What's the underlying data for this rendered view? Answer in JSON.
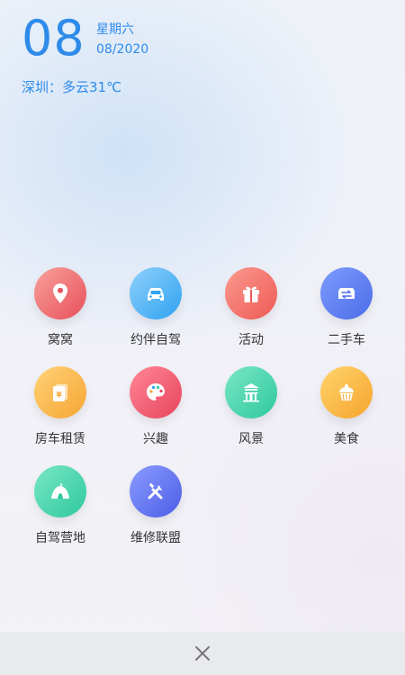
{
  "date": {
    "day": "08",
    "weekday": "星期六",
    "month_year": "08/2020",
    "weather": "深圳：多云31℃"
  },
  "menu": {
    "items": [
      {
        "label": "窝窝",
        "icon": "location-pin-icon",
        "colors": [
          "#f8a19a",
          "#e8505b"
        ]
      },
      {
        "label": "约伴自驾",
        "icon": "car-front-icon",
        "colors": [
          "#8fd0fb",
          "#2fa3f2"
        ]
      },
      {
        "label": "活动",
        "icon": "gift-icon",
        "colors": [
          "#fb9a8f",
          "#ee5a55"
        ]
      },
      {
        "label": "二手车",
        "icon": "exchange-car-icon",
        "colors": [
          "#7d9cff",
          "#4c6de8"
        ]
      },
      {
        "label": "房车租赁",
        "icon": "rental-card-icon",
        "colors": [
          "#ffd278",
          "#f6a533"
        ]
      },
      {
        "label": "兴趣",
        "icon": "palette-icon",
        "colors": [
          "#ff8796",
          "#e8445d"
        ]
      },
      {
        "label": "风景",
        "icon": "pavilion-icon",
        "colors": [
          "#7ae6c5",
          "#2dc99d"
        ]
      },
      {
        "label": "美食",
        "icon": "cupcake-icon",
        "colors": [
          "#ffd46b",
          "#f6a42d"
        ]
      },
      {
        "label": "自驾营地",
        "icon": "tent-icon",
        "colors": [
          "#7ae6c5",
          "#2dc99d"
        ]
      },
      {
        "label": "维修联盟",
        "icon": "repair-tools-icon",
        "colors": [
          "#8a9cff",
          "#4d5de6"
        ]
      }
    ]
  },
  "close_button": {
    "icon": "close-icon"
  }
}
